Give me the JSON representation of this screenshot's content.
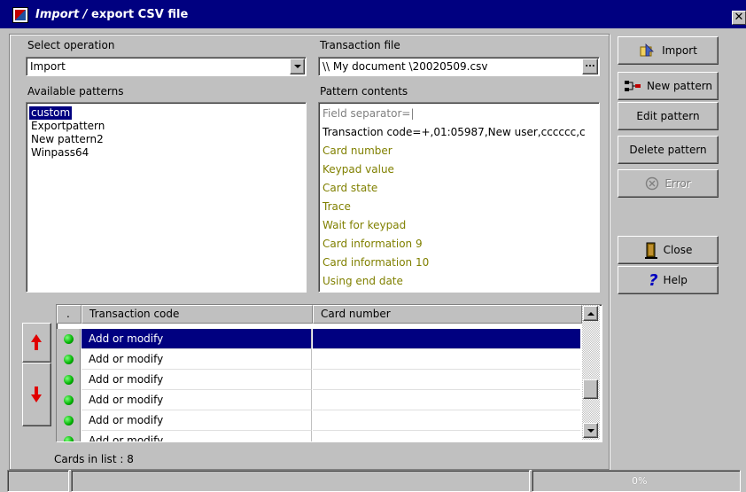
{
  "window": {
    "title_italic": "Import /",
    "title_rest": " export CSV file",
    "close_glyph": "✕"
  },
  "operation": {
    "label": "Select operation",
    "value": "Import"
  },
  "transaction_file": {
    "label": "Transaction file",
    "value": "\\\\  My document \\20020509.csv",
    "browse_label": "..."
  },
  "patterns": {
    "label": "Available patterns",
    "items": [
      "custom",
      "Exportpattern",
      "New pattern2",
      "Winpass64"
    ],
    "selected_index": 0
  },
  "pattern_contents": {
    "label": "Pattern contents",
    "lines": [
      {
        "text": "Field separator=|",
        "color": "gray"
      },
      {
        "text": "Transaction code=+,01:05987,New user,cccccc,c",
        "color": "black"
      },
      {
        "text": "Card number",
        "color": "olive"
      },
      {
        "text": "Keypad value",
        "color": "olive"
      },
      {
        "text": "Card state",
        "color": "olive"
      },
      {
        "text": "Trace",
        "color": "olive"
      },
      {
        "text": "Wait for keypad",
        "color": "olive"
      },
      {
        "text": "Card information 9",
        "color": "olive"
      },
      {
        "text": "Card information 10",
        "color": "olive"
      },
      {
        "text": "Using end date",
        "color": "olive"
      }
    ]
  },
  "buttons": {
    "import": "Import",
    "new_pattern": "New pattern",
    "edit_pattern": "Edit pattern",
    "delete_pattern": "Delete pattern",
    "error": "Error",
    "close": "Close",
    "help": "Help"
  },
  "grid": {
    "dot_header": ".",
    "columns": [
      "Transaction code",
      "Card number"
    ],
    "rows": [
      {
        "transaction_code": "Add or modify",
        "card_number": "",
        "selected": true
      },
      {
        "transaction_code": "Add or modify",
        "card_number": ""
      },
      {
        "transaction_code": "Add or modify",
        "card_number": ""
      },
      {
        "transaction_code": "Add or modify",
        "card_number": ""
      },
      {
        "transaction_code": "Add or modify",
        "card_number": ""
      },
      {
        "transaction_code": "Add or modify",
        "card_number": ""
      }
    ],
    "footer": "Cards in list : 8"
  },
  "statusbar": {
    "progress_text": "0%"
  },
  "colors": {
    "title_bar": "#000080",
    "selection": "#000080",
    "olive_text": "#808000",
    "up_arrow": "#e00000",
    "status_dot": "#00b000"
  }
}
